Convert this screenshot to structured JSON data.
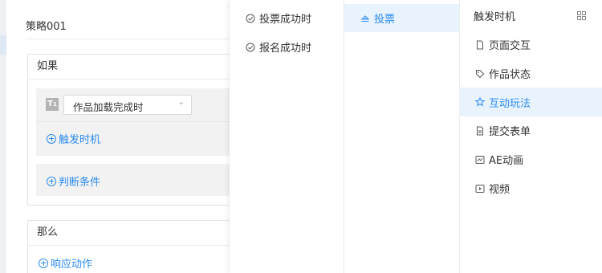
{
  "editor": {
    "strategy_name": "策略001",
    "if_section": {
      "title": "如果",
      "trigger_type_icon": "text-T1-icon",
      "trigger_select_value": "作品加载完成时",
      "add_trigger_label": "触发时机",
      "add_condition_label": "判断条件"
    },
    "then_section": {
      "title": "那么",
      "add_action_label": "响应动作"
    }
  },
  "cascader": {
    "column1": [
      {
        "label": "投票成功时",
        "icon": "check-circle-icon"
      },
      {
        "label": "报名成功时",
        "icon": "check-circle-icon"
      }
    ],
    "column2": [
      {
        "label": "投票",
        "icon": "vote-icon",
        "active": true
      }
    ],
    "column3": {
      "title": "触发时机",
      "title_icon": "grid-icon",
      "items": [
        {
          "label": "页面交互",
          "icon": "page-icon"
        },
        {
          "label": "作品状态",
          "icon": "tag-icon"
        },
        {
          "label": "互动玩法",
          "icon": "star-icon",
          "active": true
        },
        {
          "label": "提交表单",
          "icon": "form-icon"
        },
        {
          "label": "AE动画",
          "icon": "animation-icon"
        },
        {
          "label": "视频",
          "icon": "video-icon"
        }
      ]
    }
  },
  "colors": {
    "accent": "#2d8cf0",
    "active_bg": "#e8f3fe",
    "card_bg": "#f2f2f2",
    "border": "#e4e4e4"
  }
}
